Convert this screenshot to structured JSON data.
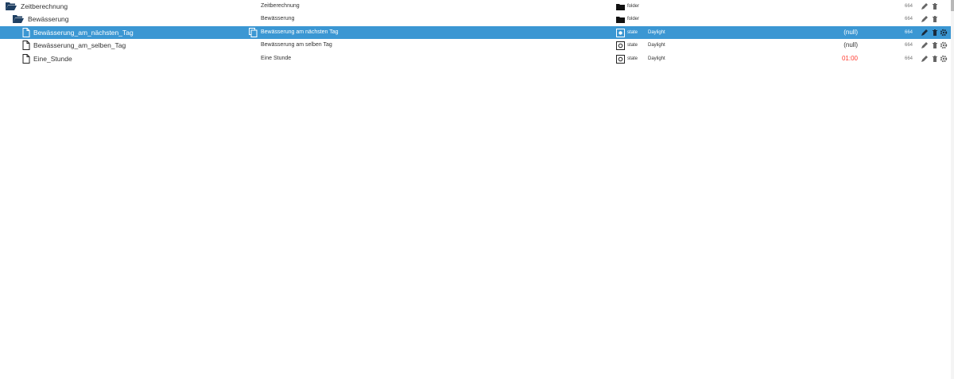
{
  "rows": [
    {
      "name": "Zeitberechnung",
      "title": "Zeitberechnung",
      "type": "folder",
      "role": "",
      "value": "",
      "acl": "664",
      "icon": "folder-open-icon",
      "type_icon": "folder-icon",
      "actions": [
        "pencil-icon",
        "trash-icon"
      ]
    },
    {
      "name": "Bewässerung",
      "title": "Bewässerung",
      "type": "folder",
      "role": "",
      "value": "",
      "acl": "664",
      "icon": "folder-open-icon",
      "type_icon": "folder-icon",
      "actions": [
        "pencil-icon",
        "trash-icon"
      ]
    },
    {
      "name": "Bewässerung_am_nächsten_Tag",
      "title": "Bewässerung am nächsten Tag",
      "type": "state",
      "role": "Daylight",
      "value": "(null)",
      "acl": "664",
      "icon": "file-icon",
      "type_icon": "state-icon",
      "actions": [
        "pencil-icon",
        "trash-icon",
        "gear-icon"
      ],
      "selected": true,
      "copy_icon": "copy-icon"
    },
    {
      "name": "Bewässerung_am_selben_Tag",
      "title": "Bewässerung am selben Tag",
      "type": "state",
      "role": "Daylight",
      "value": "(null)",
      "acl": "664",
      "icon": "file-icon",
      "type_icon": "state-icon",
      "actions": [
        "pencil-icon",
        "trash-icon",
        "gear-icon"
      ]
    },
    {
      "name": "Eine_Stunde",
      "title": "Eine Stunde",
      "type": "state",
      "role": "Daylight",
      "value": "01:00",
      "acl": "664",
      "icon": "file-icon",
      "type_icon": "state-icon",
      "actions": [
        "pencil-icon",
        "trash-icon",
        "gear-icon"
      ]
    }
  ],
  "colors": {
    "selected_row": "#3b97d3",
    "folder_icon": "#1f3f62",
    "value_highlight": "#ff3b30",
    "text": "#333333"
  }
}
